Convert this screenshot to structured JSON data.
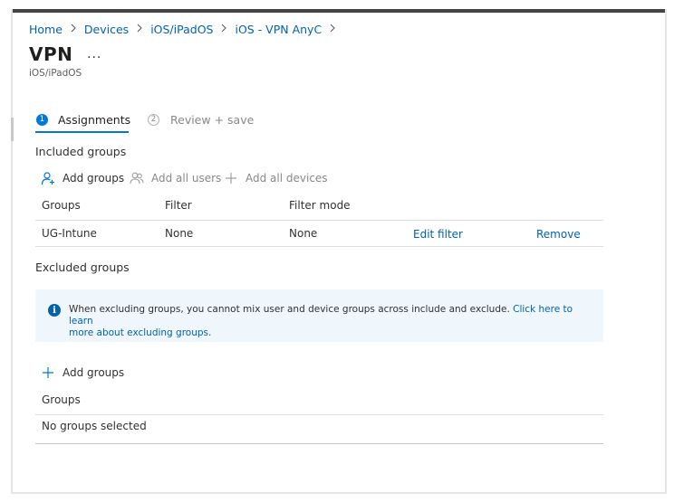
{
  "breadcrumb": {
    "items": [
      "Home",
      "Devices",
      "iOS/iPadOS",
      "iOS - VPN AnyC"
    ],
    "separator": ">"
  },
  "page": {
    "title": "VPN",
    "more": "...",
    "subtitle": "iOS/iPadOS"
  },
  "wizard": {
    "steps": [
      {
        "number": "1",
        "label": "Assignments",
        "state": "active"
      },
      {
        "number": "2",
        "label": "Review + save",
        "state": "inactive"
      }
    ]
  },
  "included": {
    "title": "Included groups",
    "commands": {
      "add_groups": "Add groups",
      "add_all_users": "Add all users",
      "add_all_devices": "Add all devices"
    },
    "columns": [
      "Groups",
      "Filter",
      "Filter mode"
    ],
    "rows": [
      {
        "group": "UG-Intune",
        "filter": "None",
        "filter_mode": "None",
        "edit_filter": "Edit filter",
        "remove": "Remove"
      }
    ]
  },
  "excluded": {
    "title": "Excluded groups",
    "info": {
      "text": "When excluding groups, you cannot mix user and device groups across include and exclude.",
      "link_line1": "Click here to learn",
      "link_line2": "more about excluding groups"
    },
    "add_groups": "Add groups",
    "column": "Groups",
    "empty": "No groups selected"
  },
  "colors": {
    "accent": "#0078d4",
    "link": "#0062ad",
    "info_background": "#eff6fc",
    "disabled_text": "#8a8886"
  },
  "icons": {
    "breadcrumb_separator": "chevron-right-icon",
    "add_groups": "add-person-icon",
    "add_all_users": "people-icon",
    "add_all_devices": "plus-icon",
    "info": "info-icon"
  }
}
